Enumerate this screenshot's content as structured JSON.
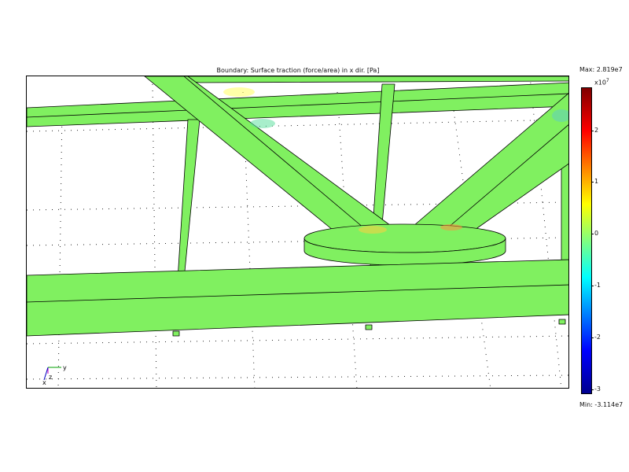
{
  "plot": {
    "title": "Boundary: Surface traction (force/area) in x dir. [Pa]"
  },
  "colorbar": {
    "max_label": "Max: 2.819e7",
    "min_label": "Min: -3.114e7",
    "exponent_base": "x10",
    "exponent_power": "7",
    "ticks": [
      "2",
      "1",
      "0",
      "-1",
      "-2",
      "-3"
    ],
    "max_value": 28190000.0,
    "min_value": -31140000.0
  },
  "axes_triad": {
    "x": "x",
    "y": "y",
    "z": "z"
  },
  "colors": {
    "surface": "#80f060",
    "edge": "#000000",
    "grid_dot": "#000000"
  }
}
